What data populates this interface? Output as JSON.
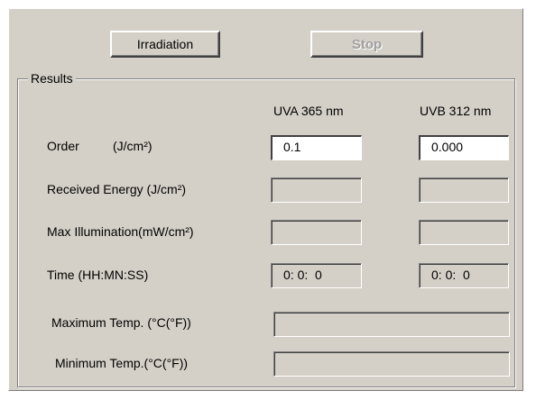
{
  "toolbar": {
    "irradiation_label": "Irradiation",
    "stop_label": "Stop"
  },
  "results": {
    "group_title": "Results",
    "columns": [
      "UVA 365 nm",
      "UVB 312 nm"
    ],
    "rows": [
      {
        "label": "Order",
        "unit": "(J/cm²)",
        "uva": "0.1",
        "uvb": "0.000"
      },
      {
        "label": "Received Energy (J/cm²)",
        "uva": "",
        "uvb": ""
      },
      {
        "label": "Max Illumination(mW/cm²)",
        "uva": "",
        "uvb": ""
      },
      {
        "label": "Time (HH:MN:SS)",
        "uva": "0: 0:  0",
        "uvb": "0: 0:  0"
      }
    ],
    "max_temp_label": "Maximum Temp. (°C(°F))",
    "max_temp_value": "",
    "min_temp_label": "Minimum Temp.(°C(°F))",
    "min_temp_value": ""
  },
  "colors": {
    "face": "#d4d0c8",
    "input_bg": "#ffffff",
    "disabled_text": "#a0a0a0"
  }
}
